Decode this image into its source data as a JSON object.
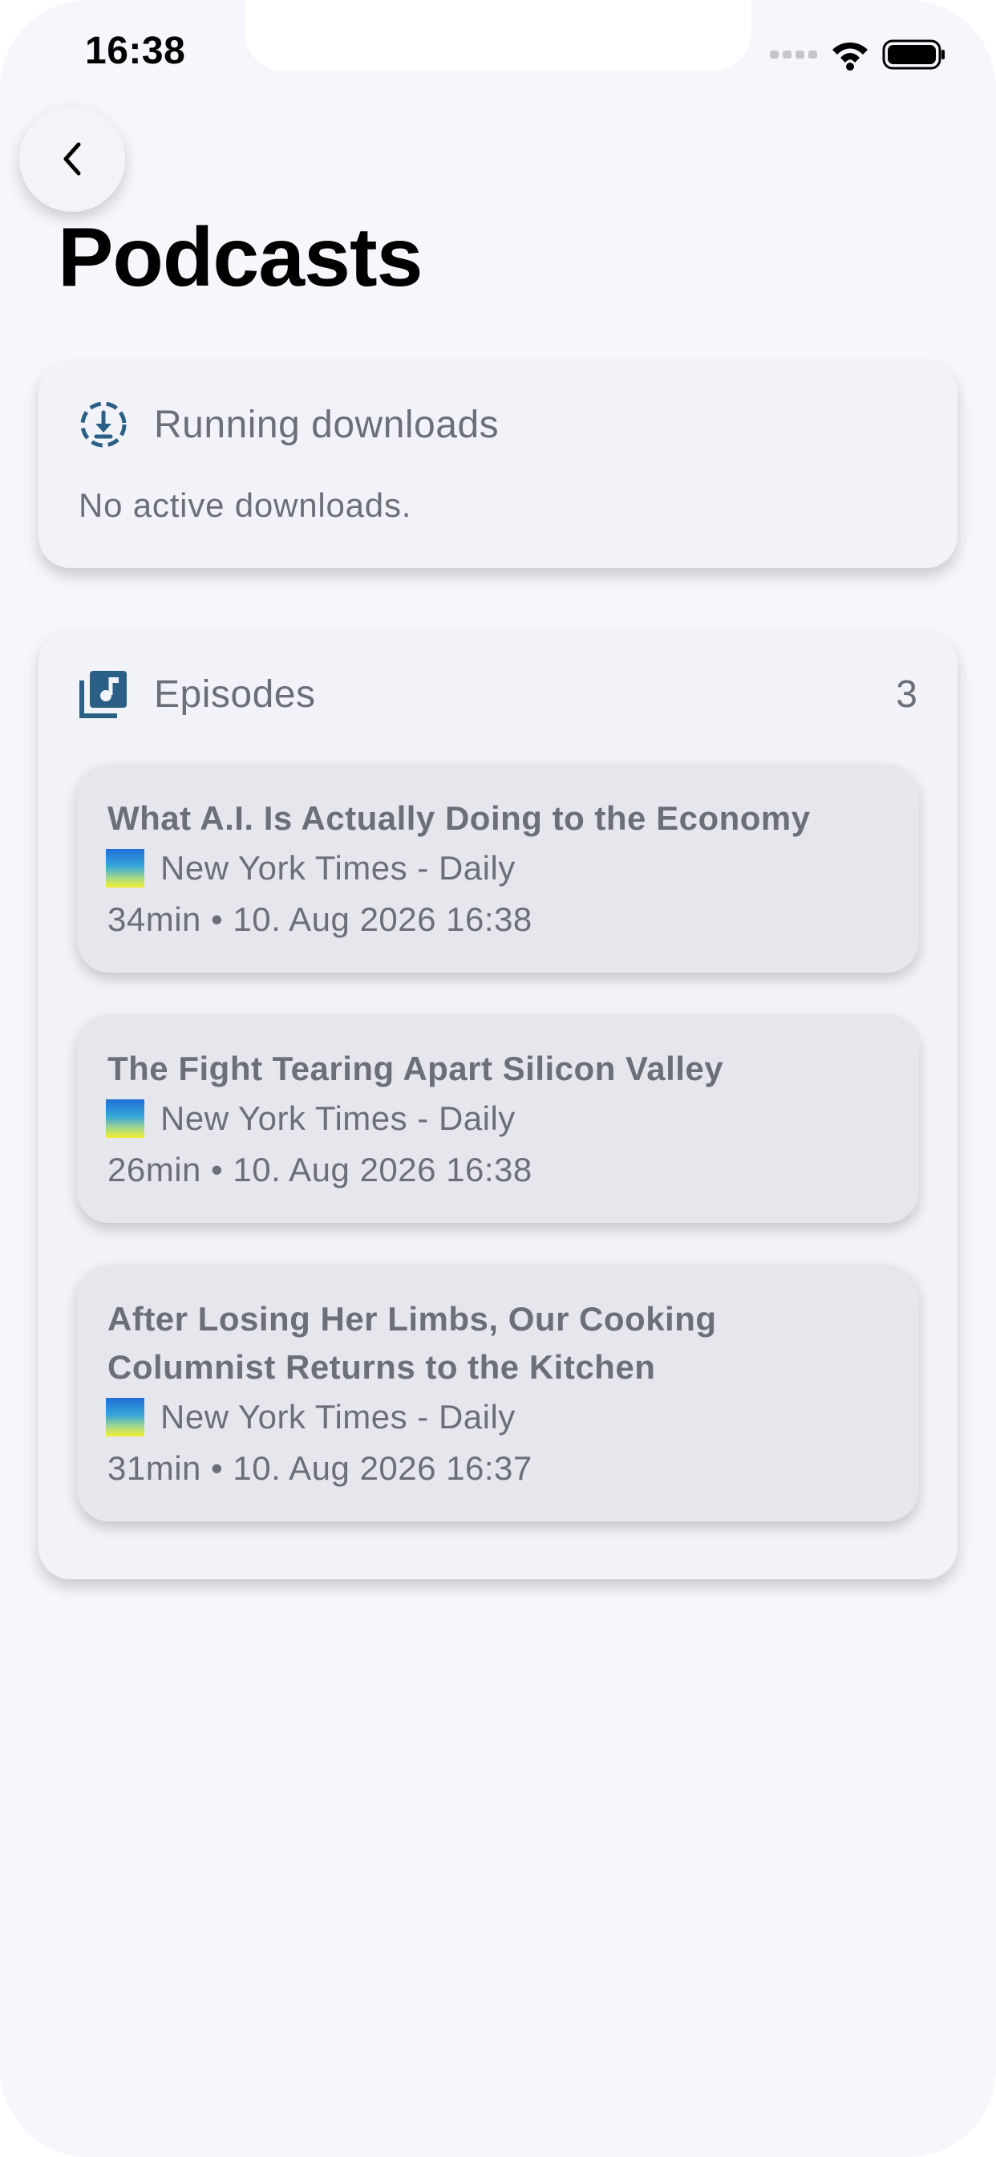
{
  "status_bar": {
    "time": "16:38",
    "icons": [
      "signal-icon",
      "wifi-icon",
      "battery-icon"
    ]
  },
  "header": {
    "back_icon": "chevron-left-icon",
    "title": "Podcasts"
  },
  "downloads": {
    "icon": "download-circle-icon",
    "label": "Running downloads",
    "empty_text": "No active downloads."
  },
  "episodes": {
    "icon": "music-library-icon",
    "label": "Episodes",
    "count": "3",
    "items": [
      {
        "title": "What A.I. Is Actually Doing to the Economy",
        "podcast": "New York Times - Daily",
        "meta": "34min • 10. Aug 2026 16:38"
      },
      {
        "title": "The Fight Tearing Apart Silicon Valley",
        "podcast": "New York Times - Daily",
        "meta": "26min • 10. Aug 2026 16:38"
      },
      {
        "title": "After Losing Her Limbs, Our Cooking Columnist Returns to the Kitchen",
        "podcast": "New York Times - Daily",
        "meta": "31min • 10. Aug 2026 16:37"
      }
    ]
  },
  "colors": {
    "background": "#f5f7fc",
    "card": "#f1f3f8",
    "episode_card": "#e5e7ec",
    "accent_icon": "#2a5f86",
    "text_muted": "#6c6f75"
  }
}
